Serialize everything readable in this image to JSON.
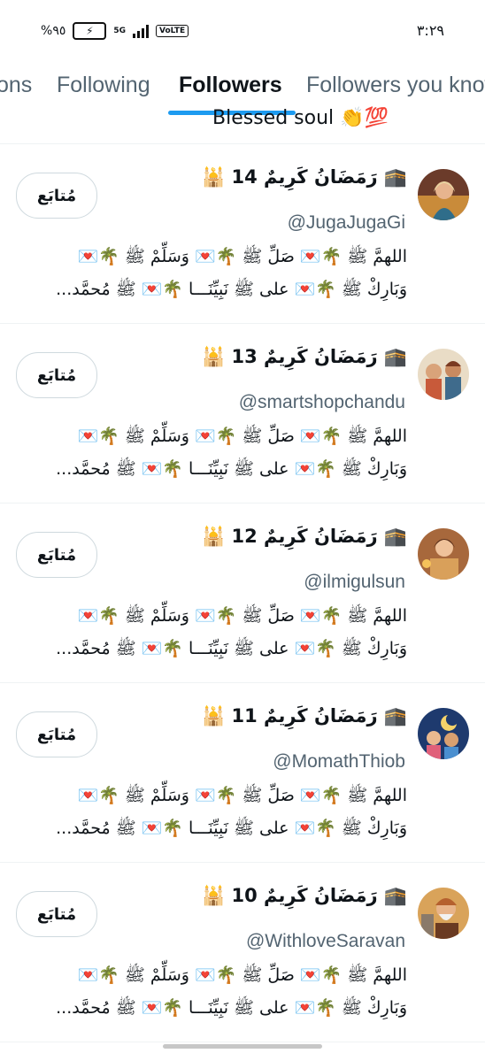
{
  "status_bar": {
    "battery": "%٩٥",
    "network": "5G",
    "volte": "VoLTE",
    "time": "٣:٢٩"
  },
  "tabs": [
    {
      "label": "ons"
    },
    {
      "label": "Following"
    },
    {
      "label": "Followers",
      "active": true
    },
    {
      "label": "Followers you know"
    }
  ],
  "previous_item_bio": "Blessed soul 👏💯",
  "follow_label": "مُتابَع",
  "users": [
    {
      "name": "🕋 رَمَضَانُ كَرِيمٌ 14 🕌",
      "handle": "@JugaJugaGi",
      "bio_line1": "اللهمَّ ﷺ 🌴💌 صَلِّ ﷺ 🌴💌 وَسَلِّمْ ﷺ 🌴💌",
      "bio_line2": "وَبَارِكْ ﷺ 🌴💌 على ﷺ نَبِيِّنَـــا 🌴💌 ﷺ مُحمَّد..."
    },
    {
      "name": "🕋 رَمَضَانُ كَرِيمٌ 13 🕌",
      "handle": "@smartshopchandu",
      "bio_line1": "اللهمَّ ﷺ 🌴💌 صَلِّ ﷺ 🌴💌 وَسَلِّمْ ﷺ 🌴💌",
      "bio_line2": "وَبَارِكْ ﷺ 🌴💌 على ﷺ نَبِيِّنَـــا 🌴💌 ﷺ مُحمَّد..."
    },
    {
      "name": "🕋 رَمَضَانُ كَرِيمٌ 12 🕌",
      "handle": "@ilmigulsun",
      "bio_line1": "اللهمَّ ﷺ 🌴💌 صَلِّ ﷺ 🌴💌 وَسَلِّمْ ﷺ 🌴💌",
      "bio_line2": "وَبَارِكْ ﷺ 🌴💌 على ﷺ نَبِيِّنَـــا 🌴💌 ﷺ مُحمَّد..."
    },
    {
      "name": "🕋 رَمَضَانُ كَرِيمٌ 11 🕌",
      "handle": "@MomathThiob",
      "bio_line1": "اللهمَّ ﷺ 🌴💌 صَلِّ ﷺ 🌴💌 وَسَلِّمْ ﷺ 🌴💌",
      "bio_line2": "وَبَارِكْ ﷺ 🌴💌 على ﷺ نَبِيِّنَـــا 🌴💌 ﷺ مُحمَّد..."
    },
    {
      "name": "🕋 رَمَضَانُ كَرِيمٌ 10 🕌",
      "handle": "@WithloveSaravan",
      "bio_line1": "اللهمَّ ﷺ 🌴💌 صَلِّ ﷺ 🌴💌 وَسَلِّمْ ﷺ 🌴💌",
      "bio_line2": "وَبَارِكْ ﷺ 🌴💌 على ﷺ نَبِيِّنَـــا 🌴💌 ﷺ مُحمَّد..."
    }
  ],
  "colors": {
    "accent": "#1d9bf0",
    "secondary_text": "#536471",
    "divider": "#eff3f4"
  }
}
